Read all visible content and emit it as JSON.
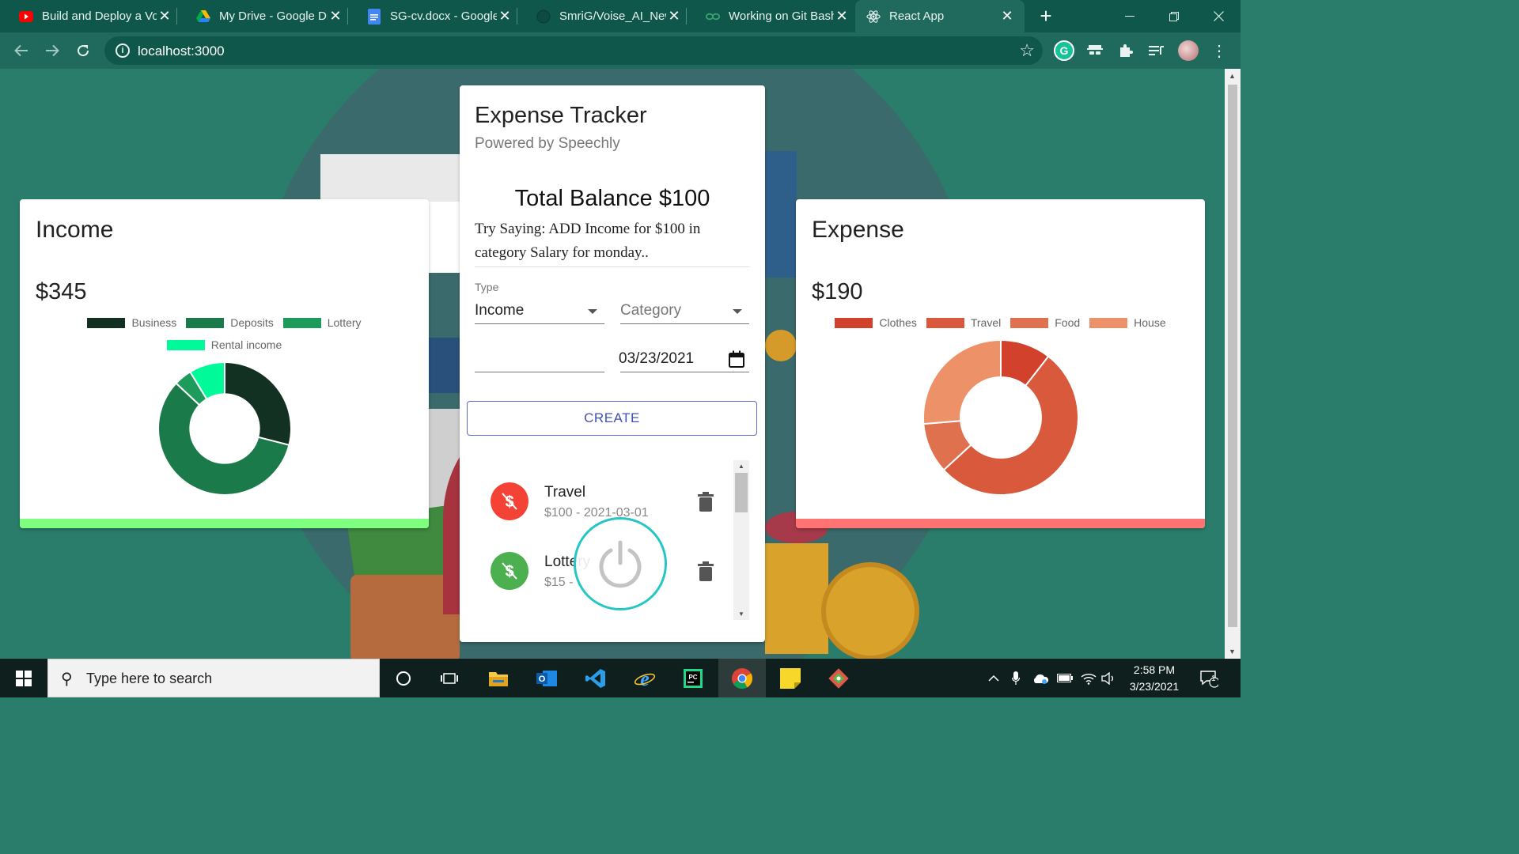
{
  "browser": {
    "tabs": [
      {
        "title": "Build and Deploy a Voice",
        "icon": "youtube-icon"
      },
      {
        "title": "My Drive - Google Drive",
        "icon": "google-drive-icon"
      },
      {
        "title": "SG-cv.docx - Google Docs",
        "icon": "google-docs-icon"
      },
      {
        "title": "SmriG/Voise_AI_New",
        "icon": "github-icon"
      },
      {
        "title": "Working on Git Bash",
        "icon": "link-icon"
      },
      {
        "title": "React App",
        "icon": "react-icon"
      }
    ],
    "address": "localhost:3000"
  },
  "income": {
    "title": "Income",
    "amount": "$345",
    "legend": [
      "Business",
      "Deposits",
      "Lottery",
      "Rental income"
    ],
    "colors": [
      "#123123",
      "#1b7a4a",
      "#1d9b5b",
      "#00fa9a"
    ],
    "accent": "#7fff7f"
  },
  "expense": {
    "title": "Expense",
    "amount": "$190",
    "legend": [
      "Clothes",
      "Travel",
      "Food",
      "House"
    ],
    "colors": [
      "#d2412c",
      "#d8593b",
      "#e0714e",
      "#ec9168"
    ],
    "accent": "#ff7373"
  },
  "chart_data": [
    {
      "type": "pie",
      "categories": [
        "Business",
        "Deposits",
        "Lottery",
        "Rental income"
      ],
      "values": [
        100,
        200,
        15,
        30
      ]
    },
    {
      "type": "pie",
      "categories": [
        "Clothes",
        "Travel",
        "Food",
        "House"
      ],
      "values": [
        20,
        100,
        20,
        50
      ]
    }
  ],
  "tracker": {
    "title": "Expense Tracker",
    "subtitle": "Powered by Speechly",
    "balance": "Total Balance $100",
    "hint": "Try Saying: ADD Income for $100 in category Salary for monday..",
    "type_label": "Type",
    "type_value": "Income",
    "category_placeholder": "Category",
    "date_value": "03/23/2021",
    "create_label": "CREATE",
    "transactions": [
      {
        "title": "Travel",
        "detail": "$100 - 2021-03-01",
        "kind": "expense",
        "color": "#f44336"
      },
      {
        "title": "Lottery",
        "detail": "$15 - ",
        "kind": "income",
        "color": "#4caf50"
      }
    ]
  },
  "taskbar": {
    "search_placeholder": "Type here to search",
    "time": "2:58 PM",
    "date": "3/23/2021",
    "notifications": "1"
  }
}
